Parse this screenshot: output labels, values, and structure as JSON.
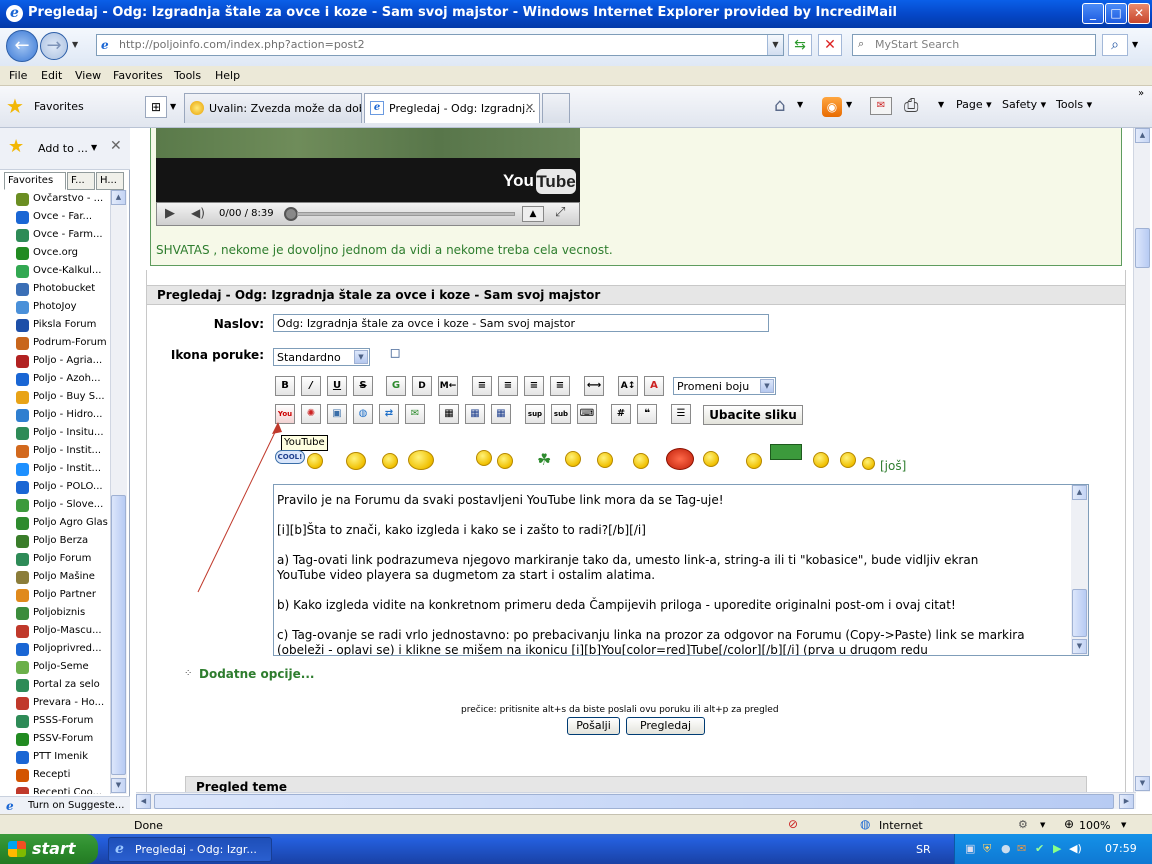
{
  "window": {
    "title": "Pregledaj - Odg: Izgradnja štale za ovce i koze - Sam svoj majstor - Windows Internet Explorer provided by IncrediMail",
    "minimize_icon": "minimize-icon",
    "maximize_icon": "maximize-icon",
    "close_icon": "close-icon"
  },
  "address_bar": {
    "url": "http://poljoinfo.com/index.php?action=post2",
    "search_placeholder": "MyStart Search"
  },
  "menu": [
    "File",
    "Edit",
    "View",
    "Favorites",
    "Tools",
    "Help"
  ],
  "favorites_bar": {
    "favorites_label": "Favorites",
    "tabs": [
      {
        "label": "Uvalin: Zvezda može da dobij...",
        "active": false
      },
      {
        "label": "Pregledaj - Odg: Izgradnj...",
        "active": true
      }
    ],
    "commands": [
      "Page",
      "Safety",
      "Tools"
    ]
  },
  "sidebar": {
    "add_to": "Add to ...",
    "tabs": [
      "Favorites",
      "F...",
      "H..."
    ],
    "items": [
      {
        "label": "Ovčarstvo - ...",
        "color": "#6b8e23"
      },
      {
        "label": "Ovce - Far...",
        "color": "#1a66d4"
      },
      {
        "label": "Ovce - Farm...",
        "color": "#2e8b57"
      },
      {
        "label": "Ovce.org",
        "color": "#228b22"
      },
      {
        "label": "Ovce-Kalkul...",
        "color": "#32a852"
      },
      {
        "label": "Photobucket",
        "color": "#3b6fb6"
      },
      {
        "label": "PhotoJoy",
        "color": "#4a90d9"
      },
      {
        "label": "Piksla Forum",
        "color": "#1d4fa8"
      },
      {
        "label": "Podrum-Forum",
        "color": "#c8661c"
      },
      {
        "label": "Poljo - Agria...",
        "color": "#b22222"
      },
      {
        "label": "Poljo - Azoh...",
        "color": "#1a66d4"
      },
      {
        "label": "Poljo - Buy S...",
        "color": "#e8a317"
      },
      {
        "label": "Poljo - Hidro...",
        "color": "#2f7fd0"
      },
      {
        "label": "Poljo - Insitu...",
        "color": "#2e8b57"
      },
      {
        "label": "Poljo - Instit...",
        "color": "#d2691e"
      },
      {
        "label": "Poljo - Instit...",
        "color": "#1e90ff"
      },
      {
        "label": "Poljo - POLO...",
        "color": "#1a66d4"
      },
      {
        "label": "Poljo - Slove...",
        "color": "#3c9a3c"
      },
      {
        "label": "Poljo Agro Glas",
        "color": "#2e8b2e"
      },
      {
        "label": "Poljo Berza",
        "color": "#3a7d2a"
      },
      {
        "label": "Poljo Forum",
        "color": "#2e8b57"
      },
      {
        "label": "Poljo Mašine",
        "color": "#8b7d3a"
      },
      {
        "label": "Poljo Partner",
        "color": "#e08a1c"
      },
      {
        "label": "Poljobiznis",
        "color": "#3c8c3c"
      },
      {
        "label": "Poljo-Mascu...",
        "color": "#c0392b"
      },
      {
        "label": "Poljoprivred...",
        "color": "#1a66d4"
      },
      {
        "label": "Poljo-Seme",
        "color": "#6bb04a"
      },
      {
        "label": "Portal za selo",
        "color": "#2e8b57"
      },
      {
        "label": "Prevara - Ho...",
        "color": "#c0392b"
      },
      {
        "label": "PSSS-Forum",
        "color": "#2e8b57"
      },
      {
        "label": "PSSV-Forum",
        "color": "#228b22"
      },
      {
        "label": "PTT Imenik",
        "color": "#1a66d4"
      },
      {
        "label": "Recepti",
        "color": "#d35400"
      },
      {
        "label": "Recepti Coo...",
        "color": "#c0392b"
      }
    ],
    "suggest": "Turn on Suggeste..."
  },
  "video": {
    "brand": "YouTube",
    "time": "0/00 / 8:39"
  },
  "previous_post_text": "SHVATAS , nekome je dovoljno jednom da vidi a nekome treba cela vecnost.",
  "form": {
    "header": "Pregledaj - Odg: Izgradnja štale za ovce i koze - Sam svoj majstor",
    "title_label": "Naslov:",
    "title_value": "Odg: Izgradnja štale za ovce i koze - Sam svoj majstor",
    "icon_label": "Ikona poruke:",
    "icon_value": "Standardno",
    "color_select": "Promeni boju",
    "insert_image": "Ubacite sliku",
    "tooltip": "YouTube",
    "more_smileys": "[još]",
    "message_lines": [
      "Pravilo je na Forumu da svaki postavljeni YouTube link mora da se Tag-uje!",
      "[i][b]Šta to znači, kako izgleda i kako se i zašto to radi?[/b][/i]",
      "a) Tag-ovati link podrazumeva njegovo markiranje tako da, umesto link-a, string-a ili ti \"kobasice\", bude vidljiv ekran",
      "YouTube video playera sa dugmetom za start i ostalim alatima.",
      "b) Kako izgleda vidite na konkretnom primeru deda Čampijevih priloga - uporedite originalni post-om i ovaj citat!",
      "c) Tag-ovanje se radi vrlo jednostavno: po prebacivanju linka na prozor za odgovor na Forumu (Copy->Paste) link se markira",
      "(obeleži - oplavi se) i klikne se mišem na ikonicu [i][b]You[color=red]Tube[/color][/b][/i] (prva u drugom redu"
    ],
    "additional_options": "Dodatne opcije...",
    "shortcut_hint": "prečice: pritisnite alt+s da biste poslali ovu poruku ili alt+p za pregled",
    "send_button": "Pošalji",
    "preview_button": "Pregledaj",
    "topic_preview": "Pregled teme"
  },
  "status_bar": {
    "status": "Done",
    "zone": "Internet",
    "zoom": "100%"
  },
  "taskbar": {
    "start": "start",
    "window_button": "Pregledaj - Odg: Izgr...",
    "language": "SR",
    "clock": "07:59"
  }
}
